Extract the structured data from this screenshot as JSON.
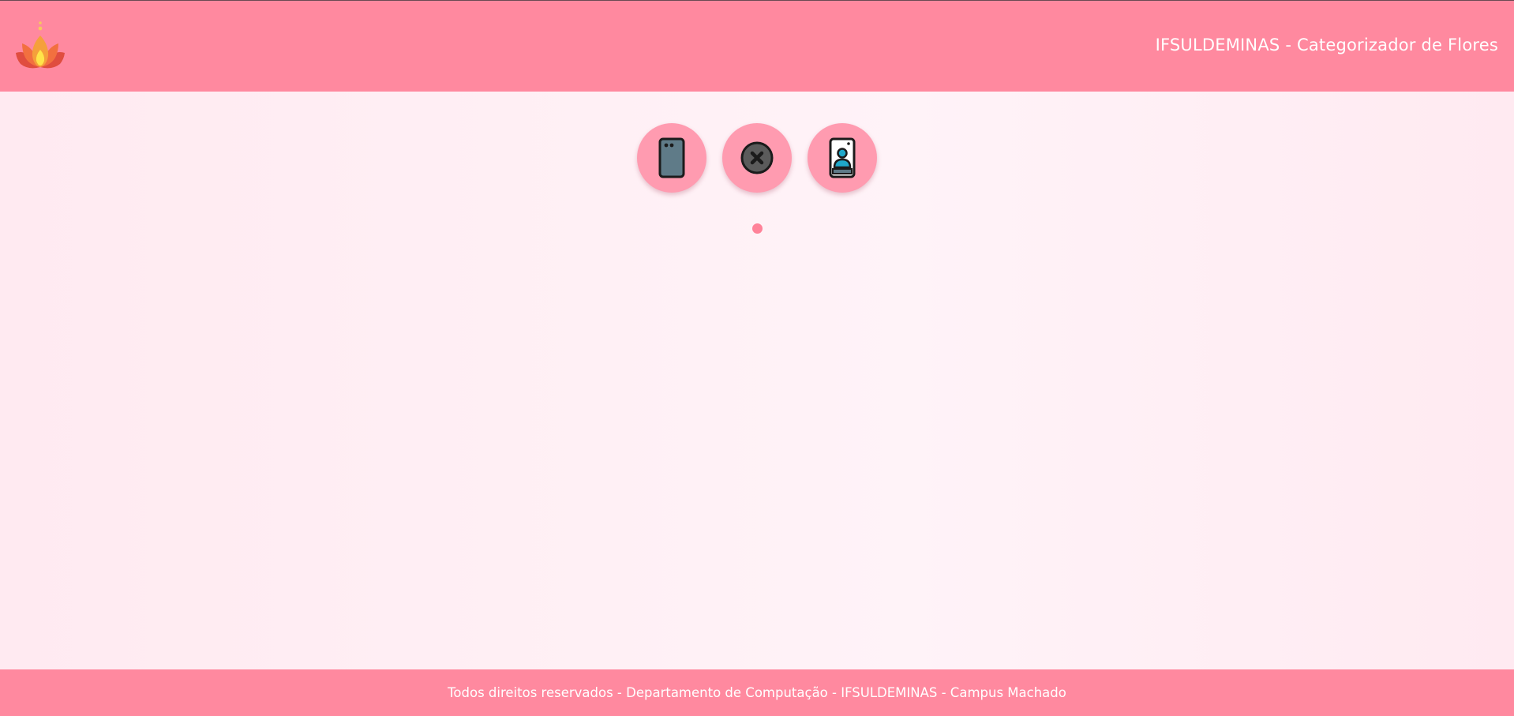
{
  "header": {
    "title": "IFSULDEMINAS - Categorizador de Flores",
    "logo_icon": "lotus-flame-icon",
    "background": "#ff899f"
  },
  "actions": [
    {
      "icon": "phone-back-icon"
    },
    {
      "icon": "close-circle-icon"
    },
    {
      "icon": "phone-front-camera-icon"
    }
  ],
  "footer": {
    "text": "Todos direitos reservados - Departamento de Computação - IFSULDEMINAS - Campus Machado"
  },
  "colors": {
    "accent": "#ff899f",
    "button": "#ff9bb0",
    "background": "#fff0f5"
  }
}
